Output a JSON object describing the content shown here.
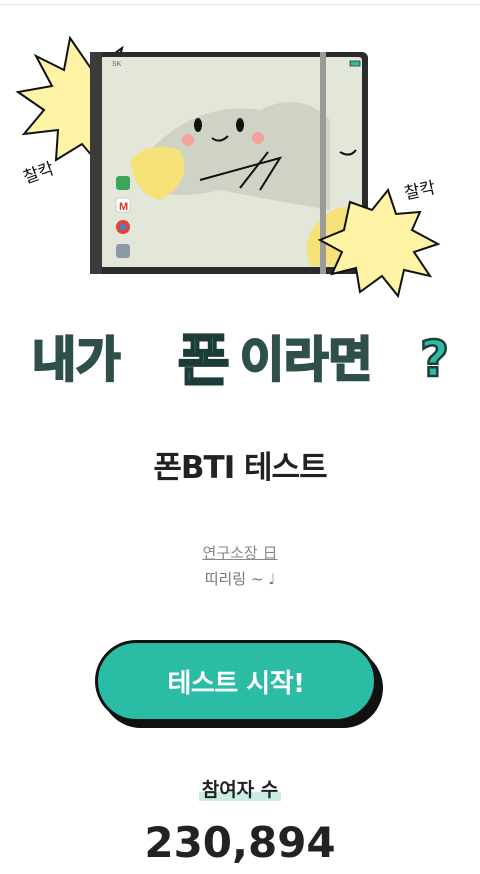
{
  "hero": {
    "sfx_left": "찰칵",
    "sfx_right": "찰칵",
    "carrier": "SK"
  },
  "banner": {
    "part1": "내가",
    "part2": "폰",
    "part3": "이라면",
    "mark": "?"
  },
  "page": {
    "title": "폰BTI 테스트"
  },
  "credits": {
    "author": "연구소장 日",
    "tagline": "띠리링 ~ ♩"
  },
  "actions": {
    "start_label": "테스트 시작!"
  },
  "stats": {
    "participants_label": "참여자 수",
    "participants_count": "230,894"
  },
  "colors": {
    "accent": "#2bbca6",
    "burst": "#fff3a6",
    "screen": "#e3e7da"
  }
}
